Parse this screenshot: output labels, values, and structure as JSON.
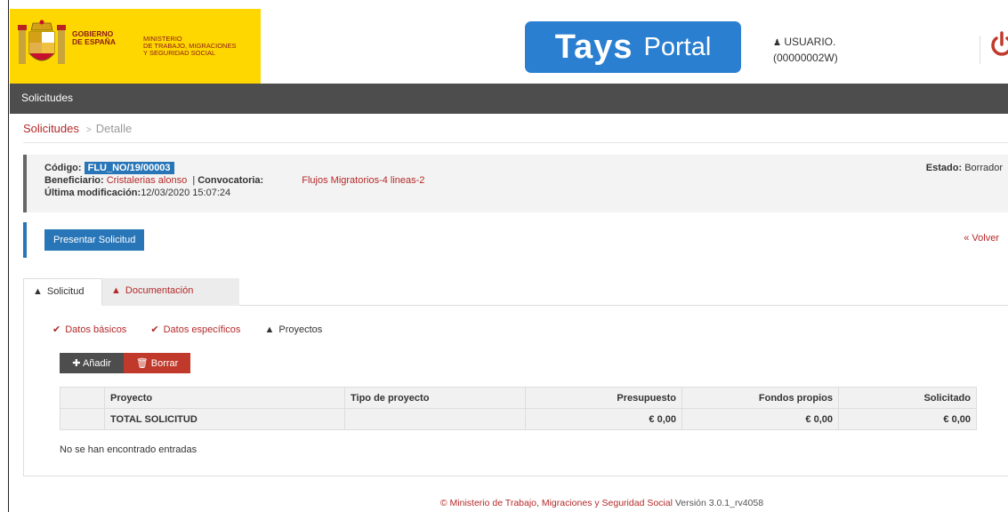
{
  "header": {
    "gov_line1": "GOBIERNO",
    "gov_line2": "DE ESPAÑA",
    "ministry_line1": "MINISTERIO",
    "ministry_line2": "DE TRABAJO, MIGRACIONES",
    "ministry_line3": "Y SEGURIDAD SOCIAL",
    "logo_bold": "Tays",
    "logo_light": "Portal",
    "user_label": "USUARIO.",
    "user_id": "(00000002W)",
    "user_icon": "user-icon",
    "power_icon": "power-icon",
    "brand_yellow": "#ffd700",
    "logo_blue": "#2b7fd1"
  },
  "navbar": {
    "item": "Solicitudes"
  },
  "breadcrumb": {
    "link": "Solicitudes",
    "separator": ">",
    "current": "Detalle"
  },
  "info": {
    "codigo_label": "Código:",
    "codigo_value": "FLU_NO/19/00003",
    "beneficiario_label": "Beneficiario:",
    "beneficiario_value": "Cristalerias alonso",
    "pipe": "|",
    "convocatoria_label": "Convocatoria:",
    "convocatoria_value": "Flujos Migratorios-4 lineas-2",
    "modificacion_label": "Última modificación:",
    "modificacion_value": "12/03/2020 15:07:24",
    "estado_label": "Estado:",
    "estado_value": "Borrador"
  },
  "actions": {
    "present_label": "Presentar Solicitud",
    "volver_label": "« Volver"
  },
  "tabs": [
    {
      "label": "Solicitud",
      "icon": "warning-icon"
    },
    {
      "label": "Documentación",
      "icon": "warning-icon"
    }
  ],
  "subnav": [
    {
      "label": "Datos básicos",
      "icon": "check-icon"
    },
    {
      "label": "Datos específicos",
      "icon": "check-icon"
    },
    {
      "label": "Proyectos",
      "icon": "warning-icon"
    }
  ],
  "buttons": {
    "add_label": "Añadir",
    "delete_label": "Borrar"
  },
  "table": {
    "headers": [
      "Proyecto",
      "Tipo de proyecto",
      "Presupuesto",
      "Fondos propios",
      "Solicitado"
    ],
    "total_row": {
      "label": "TOTAL SOLICITUD",
      "tipo": "",
      "presupuesto": "€ 0,00",
      "fondos": "€ 0,00",
      "solicitado": "€ 0,00"
    },
    "empty_message": "No se han encontrado entradas"
  },
  "footer": {
    "copyright": "© Ministerio de Trabajo, Migraciones y Seguridad Social",
    "version": "Versión 3.0.1_rv4058"
  },
  "colors": {
    "accent_red": "#b52929",
    "primary_blue": "#2876b8",
    "navbar": "#4d4d4d"
  }
}
